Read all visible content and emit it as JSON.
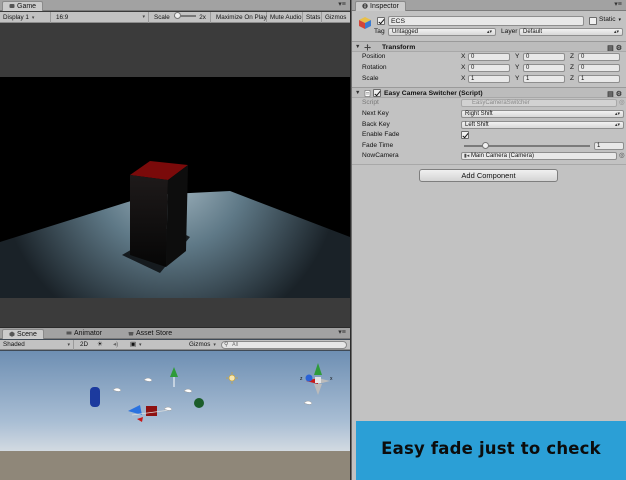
{
  "game": {
    "tab_label": "Game",
    "display": "Display 1",
    "aspect": "16:9",
    "scale_label": "Scale",
    "scale_value": "2x",
    "maximize_on_play": "Maximize On Play",
    "mute_audio": "Mute Audio",
    "stats": "Stats",
    "gizmos": "Gizmos"
  },
  "scene": {
    "tabs": [
      {
        "label": "Scene"
      },
      {
        "label": "Animator"
      },
      {
        "label": "Asset Store"
      }
    ],
    "shading_mode": "Shaded",
    "mode_2d": "2D",
    "gizmos": "Gizmos",
    "search_placeholder": "All",
    "persp_label": "Persp"
  },
  "inspector": {
    "tab_label": "Inspector",
    "object_name": "ECS",
    "static_label": "Static",
    "tag_label": "Tag",
    "tag_value": "Untagged",
    "layer_label": "Layer",
    "layer_value": "Default",
    "transform": {
      "title": "Transform",
      "position_label": "Position",
      "rotation_label": "Rotation",
      "scale_label": "Scale",
      "position": {
        "x": "0",
        "y": "0",
        "z": "0"
      },
      "rotation": {
        "x": "0",
        "y": "0",
        "z": "0"
      },
      "scale": {
        "x": "1",
        "y": "1",
        "z": "1"
      }
    },
    "script_component": {
      "title": "Easy Camera Switcher (Script)",
      "script_label": "Script",
      "script_value": "EasyCameraSwitcher",
      "next_key_label": "Next Key",
      "next_key_value": "Right Shift",
      "back_key_label": "Back Key",
      "back_key_value": "Left Shift",
      "enable_fade_label": "Enable Fade",
      "enable_fade_checked": true,
      "fade_time_label": "Fade Time",
      "fade_time_value": "1",
      "now_camera_label": "NowCamera",
      "now_camera_value": "Main Camera (Camera)"
    },
    "add_component": "Add Component"
  },
  "banner": {
    "text": "Easy fade just to check"
  },
  "colors": {
    "banner_bg": "#2b9fd6",
    "inspector_bg": "#c2c2c2",
    "cube_top": "#7a0a0a"
  }
}
